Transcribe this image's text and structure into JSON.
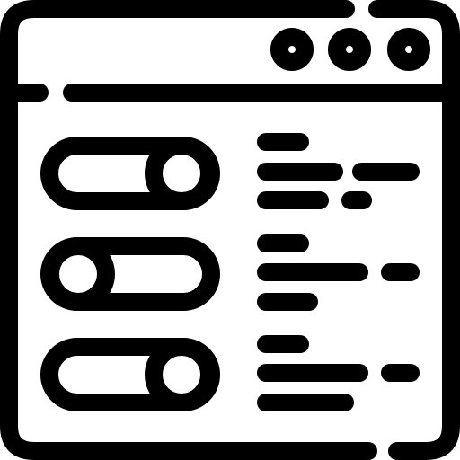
{
  "icon": {
    "name": "settings-window-toggles-icon",
    "stroke_color": "#000000",
    "fill_color": "#ffffff"
  },
  "window": {
    "titlebar_controls": [
      {
        "name": "window-control-1"
      },
      {
        "name": "window-control-2"
      },
      {
        "name": "window-control-3"
      }
    ]
  },
  "settings": {
    "rows": [
      {
        "toggle_state": "on"
      },
      {
        "toggle_state": "off"
      },
      {
        "toggle_state": "on"
      }
    ]
  }
}
